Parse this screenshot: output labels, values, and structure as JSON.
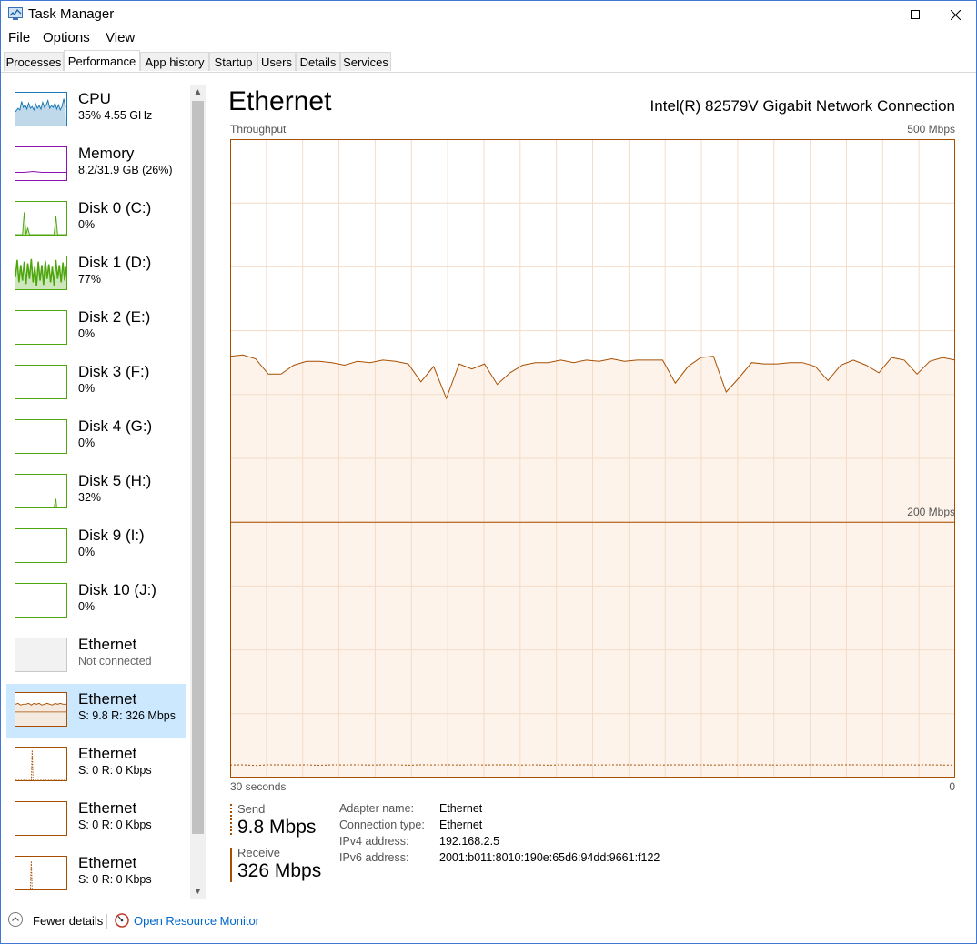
{
  "window": {
    "title": "Task Manager"
  },
  "menu": {
    "items": [
      "File",
      "Options",
      "View"
    ]
  },
  "tabs": [
    {
      "label": "Processes"
    },
    {
      "label": "Performance"
    },
    {
      "label": "App history"
    },
    {
      "label": "Startup"
    },
    {
      "label": "Users"
    },
    {
      "label": "Details"
    },
    {
      "label": "Services"
    }
  ],
  "active_tab": "Performance",
  "sidebar": {
    "items": [
      {
        "title": "CPU",
        "subtitle": "35%  4.55 GHz",
        "color": "#1a78b4",
        "icon": "cpu-graph"
      },
      {
        "title": "Memory",
        "subtitle": "8.2/31.9 GB (26%)",
        "color": "#8b12ae",
        "icon": "memory-graph"
      },
      {
        "title": "Disk 0 (C:)",
        "subtitle": "0%",
        "color": "#4da60c",
        "icon": "disk-graph"
      },
      {
        "title": "Disk 1 (D:)",
        "subtitle": "77%",
        "color": "#4da60c",
        "icon": "disk-graph"
      },
      {
        "title": "Disk 2 (E:)",
        "subtitle": "0%",
        "color": "#4da60c",
        "icon": "disk-graph"
      },
      {
        "title": "Disk 3 (F:)",
        "subtitle": "0%",
        "color": "#4da60c",
        "icon": "disk-graph"
      },
      {
        "title": "Disk 4 (G:)",
        "subtitle": "0%",
        "color": "#4da60c",
        "icon": "disk-graph"
      },
      {
        "title": "Disk 5 (H:)",
        "subtitle": "32%",
        "color": "#4da60c",
        "icon": "disk-graph"
      },
      {
        "title": "Disk 9 (I:)",
        "subtitle": "0%",
        "color": "#4da60c",
        "icon": "disk-graph"
      },
      {
        "title": "Disk 10 (J:)",
        "subtitle": "0%",
        "color": "#4da60c",
        "icon": "disk-graph"
      },
      {
        "title": "Ethernet",
        "subtitle": "Not connected",
        "color": "#a0a0a0",
        "icon": "ethernet-graph"
      },
      {
        "title": "Ethernet",
        "subtitle": "S: 9.8  R: 326 Mbps",
        "color": "#a74f01",
        "icon": "ethernet-graph"
      },
      {
        "title": "Ethernet",
        "subtitle": "S: 0  R: 0 Kbps",
        "color": "#a74f01",
        "icon": "ethernet-graph"
      },
      {
        "title": "Ethernet",
        "subtitle": "S: 0  R: 0 Kbps",
        "color": "#a74f01",
        "icon": "ethernet-graph"
      },
      {
        "title": "Ethernet",
        "subtitle": "S: 0  R: 0 Kbps",
        "color": "#a74f01",
        "icon": "ethernet-graph"
      }
    ],
    "selected_index": 11
  },
  "main": {
    "title": "Ethernet",
    "adapter_description": "Intel(R) 82579V Gigabit Network Connection",
    "chart_label": "Throughput",
    "max_label": "500 Mbps",
    "mid_label": "200 Mbps",
    "axis_left": "30 seconds",
    "axis_right": "0",
    "send_label": "Send",
    "send_value": "9.8 Mbps",
    "receive_label": "Receive",
    "receive_value": "326 Mbps",
    "info": [
      {
        "label": "Adapter name:",
        "value": "Ethernet"
      },
      {
        "label": "Connection type:",
        "value": "Ethernet"
      },
      {
        "label": "IPv4 address:",
        "value": "192.168.2.5"
      },
      {
        "label": "IPv6 address:",
        "value": "2001:b011:8010:190e:65d6:94dd:9661:f122"
      }
    ]
  },
  "footer": {
    "fewer_details": "Fewer details",
    "open_resource_monitor": "Open Resource Monitor"
  },
  "colors": {
    "accent": "#a74f01",
    "chart_fill": "#fdf3ea",
    "grid": "#f4dcc8",
    "selected_bg": "#cce8ff"
  },
  "chart_data": {
    "type": "line",
    "title": "Throughput",
    "xlabel": "30 seconds",
    "ylabel": "",
    "ylim": [
      0,
      500
    ],
    "x_range": [
      30,
      0
    ],
    "series": [
      {
        "name": "Receive",
        "values": [
          330,
          331,
          328,
          316,
          316,
          323,
          326,
          326,
          325,
          323,
          326,
          325,
          327,
          326,
          324,
          310,
          322,
          297,
          324,
          320,
          324,
          308,
          317,
          323,
          325,
          325,
          327,
          325,
          327,
          326,
          328,
          326,
          327,
          327,
          327,
          309,
          322,
          329,
          330,
          302,
          313,
          325,
          324,
          324,
          325,
          325,
          322,
          311,
          323,
          327,
          323,
          317,
          329,
          327,
          316,
          326,
          329,
          327
        ]
      },
      {
        "name": "Send",
        "values": [
          9.8,
          10,
          9.5,
          10,
          10,
          9.8,
          10,
          9.6,
          10,
          9.9,
          10,
          9.8,
          10,
          10,
          9.7,
          10,
          9.9,
          10,
          9.8,
          10,
          9.9,
          10,
          10,
          9.8,
          10,
          9.7,
          10,
          9.9,
          10,
          9.8,
          10,
          10,
          9.9,
          10,
          9.8,
          10,
          9.9,
          10,
          9.8,
          10,
          9.9,
          10,
          10,
          9.8,
          10,
          9.9,
          10,
          9.8,
          10,
          10,
          9.9,
          10,
          9.8,
          10,
          9.9,
          10,
          9.8,
          9.8
        ]
      }
    ]
  }
}
